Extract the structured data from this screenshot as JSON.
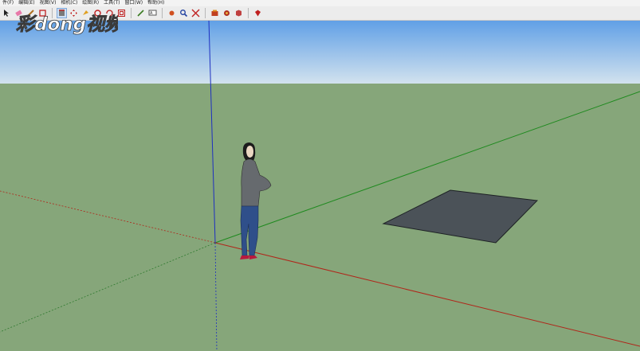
{
  "menu": [
    "件(F)",
    "编辑(E)",
    "视图(V)",
    "相机(C)",
    "绘图(R)",
    "工具(T)",
    "窗口(W)",
    "帮助(H)"
  ],
  "toolbar_icons": [
    "select-arrow-icon",
    "eraser-icon",
    "pencil-line-icon",
    "rectangle-icon",
    "push-pull-icon",
    "move-icon",
    "paint-icon",
    "orbit-icon",
    "rotate-icon",
    "offset-icon",
    "tape-measure-icon",
    "text-icon",
    "pan-icon",
    "zoom-icon",
    "zoom-extents-icon",
    "warehouse-icon",
    "extension-icon",
    "layout-icon"
  ],
  "watermark": {
    "text": "彩dong视频"
  },
  "scene": {
    "sky_color": "#5f9fe6",
    "ground_color": "#86a67a",
    "face_color": "#4b5258"
  }
}
